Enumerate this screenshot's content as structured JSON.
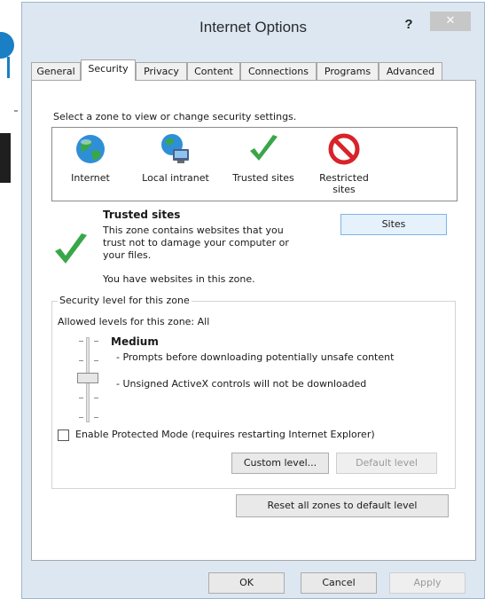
{
  "window": {
    "title": "Internet Options",
    "help_label": "?",
    "close_label": "✕"
  },
  "tabs": [
    {
      "label": "General"
    },
    {
      "label": "Security"
    },
    {
      "label": "Privacy"
    },
    {
      "label": "Content"
    },
    {
      "label": "Connections"
    },
    {
      "label": "Programs"
    },
    {
      "label": "Advanced"
    }
  ],
  "security": {
    "zone_prompt": "Select a zone to view or change security settings.",
    "zones": [
      {
        "label": "Internet",
        "icon": "globe-icon"
      },
      {
        "label": "Local intranet",
        "icon": "intranet-icon"
      },
      {
        "label": "Trusted sites",
        "icon": "checkmark-icon"
      },
      {
        "label": "Restricted sites",
        "icon": "restricted-icon"
      }
    ],
    "selected_zone": {
      "title": "Trusted sites",
      "description": "This zone contains websites that you trust not to damage your computer or your files.",
      "note": "You have websites in this zone.",
      "sites_button": "Sites"
    },
    "level_group": {
      "legend": "Security level for this zone",
      "allowed": "Allowed levels for this zone: All",
      "level_name": "Medium",
      "bullets": [
        "- Prompts before downloading potentially unsafe content",
        "- Unsigned ActiveX controls will not be downloaded"
      ],
      "protected_mode_label": "Enable Protected Mode (requires restarting Internet Explorer)",
      "protected_mode_checked": false,
      "custom_level_button": "Custom level...",
      "default_level_button": "Default level"
    },
    "reset_all_button": "Reset all zones to default level"
  },
  "footer": {
    "ok": "OK",
    "cancel": "Cancel",
    "apply": "Apply"
  },
  "colors": {
    "dialog_bg": "#dce7f2",
    "accent_border": "#7eb4ea",
    "check_green": "#3aa64a",
    "restricted_red": "#d8232a"
  }
}
